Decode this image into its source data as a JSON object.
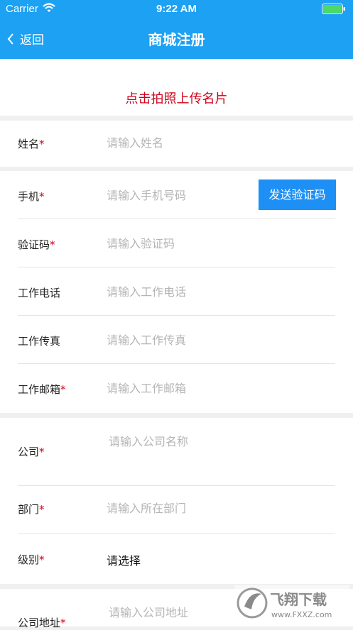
{
  "status_bar": {
    "carrier": "Carrier",
    "time": "9:22 AM"
  },
  "nav": {
    "back_label": "返回",
    "title": "商城注册"
  },
  "upload": {
    "label": "点击拍照上传名片"
  },
  "fields": {
    "name": {
      "label": "姓名",
      "required": "*",
      "placeholder": "请输入姓名"
    },
    "phone": {
      "label": "手机",
      "required": "*",
      "placeholder": "请输入手机号码",
      "button": "发送验证码"
    },
    "code": {
      "label": "验证码",
      "required": "*",
      "placeholder": "请输入验证码"
    },
    "work_phone": {
      "label": "工作电话",
      "placeholder": "请输入工作电话"
    },
    "work_fax": {
      "label": "工作传真",
      "placeholder": "请输入工作传真"
    },
    "work_email": {
      "label": "工作邮箱",
      "required": "*",
      "placeholder": "请输入工作邮箱"
    },
    "company": {
      "label": "公司",
      "required": "*",
      "placeholder": "请输入公司名称"
    },
    "department": {
      "label": "部门",
      "required": "*",
      "placeholder": "请输入所在部门"
    },
    "level": {
      "label": "级别",
      "required": "*",
      "value": "请选择"
    },
    "address": {
      "label": "公司地址",
      "required": "*",
      "placeholder": "请输入公司地址"
    }
  },
  "watermark": {
    "text_cn": "飞翔下载",
    "text_url": "www.FXXZ.com"
  },
  "colors": {
    "primary": "#1da1f2",
    "button": "#1e90f5",
    "required": "#d0021b",
    "battery": "#4cd964"
  }
}
